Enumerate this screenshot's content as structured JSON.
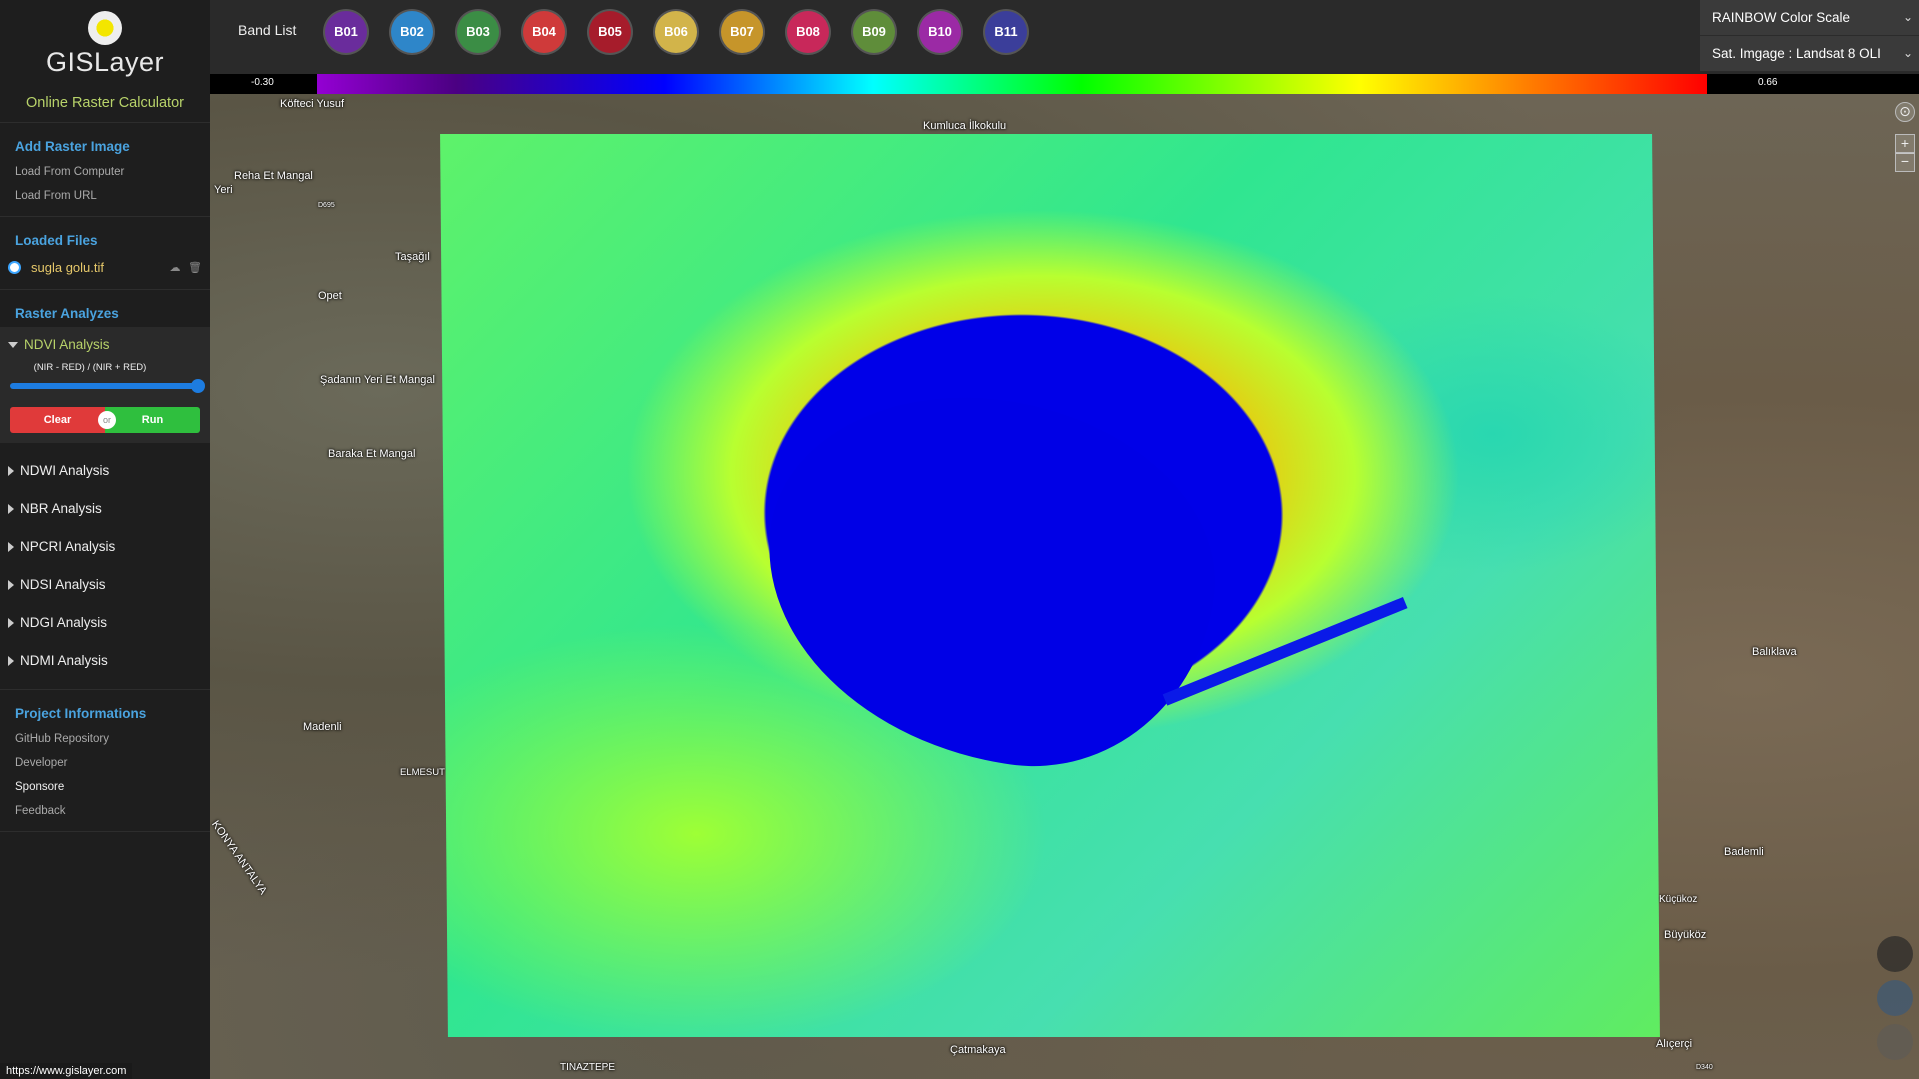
{
  "app": {
    "title": "GISLayer",
    "subtitle": "Online Raster Calculator",
    "status_url": "https://www.gislayer.com"
  },
  "sidebar": {
    "add_raster": {
      "title": "Add Raster Image",
      "items": [
        "Load From Computer",
        "Load From URL"
      ]
    },
    "loaded_files": {
      "title": "Loaded Files",
      "files": [
        {
          "name": "sugla golu.tif",
          "selected": true
        }
      ]
    },
    "raster_analyzes": {
      "title": "Raster Analyzes",
      "active": {
        "label": "NDVI Analysis",
        "formula": "(NIR - RED) / (NIR + RED)",
        "clear_label": "Clear",
        "or_label": "or",
        "run_label": "Run",
        "slider_fraction": 1.0
      },
      "collapsed": [
        "NDWI Analysis",
        "NBR Analysis",
        "NPCRI Analysis",
        "NDSI Analysis",
        "NDGI Analysis",
        "NDMI Analysis"
      ]
    },
    "project": {
      "title": "Project Informations",
      "links": [
        "GitHub Repository",
        "Developer",
        "Sponsore",
        "Feedback"
      ]
    }
  },
  "topbar": {
    "band_list_label": "Band List",
    "bands": [
      {
        "label": "B01",
        "color": "#6a2c9c"
      },
      {
        "label": "B02",
        "color": "#2e86c9"
      },
      {
        "label": "B03",
        "color": "#3b8d45"
      },
      {
        "label": "B04",
        "color": "#cf3a3a"
      },
      {
        "label": "B05",
        "color": "#a61c2b"
      },
      {
        "label": "B06",
        "color": "#d2b44a"
      },
      {
        "label": "B07",
        "color": "#c6952a"
      },
      {
        "label": "B08",
        "color": "#c8285a"
      },
      {
        "label": "B09",
        "color": "#5f8d3a"
      },
      {
        "label": "B10",
        "color": "#9b2aa5"
      },
      {
        "label": "B11",
        "color": "#3b3e9a"
      }
    ],
    "color_scale_select": "RAINBOW Color Scale",
    "sat_image_select": "Sat. Imgage : Landsat 8 OLI"
  },
  "color_scale": {
    "min": "-0.30",
    "max": "0.66"
  },
  "map": {
    "places": [
      "Köfteci Yusuf",
      "Reha Et Mangal",
      "Taşağıl",
      "Opet",
      "Şadanın Yeri Et Mangal",
      "Baraka Et Mangal",
      "Madenli",
      "ELMESUT",
      "KONYA ANTALYA",
      "Kumluca İlkokulu",
      "Balıklava",
      "Bademli",
      "Küçükoz",
      "Büyüköz",
      "Alıçerçi",
      "Çatmakaya",
      "TINAZTEPE",
      "Yeri",
      "D695",
      "D340"
    ],
    "zoom_in": "+",
    "zoom_out": "−"
  }
}
